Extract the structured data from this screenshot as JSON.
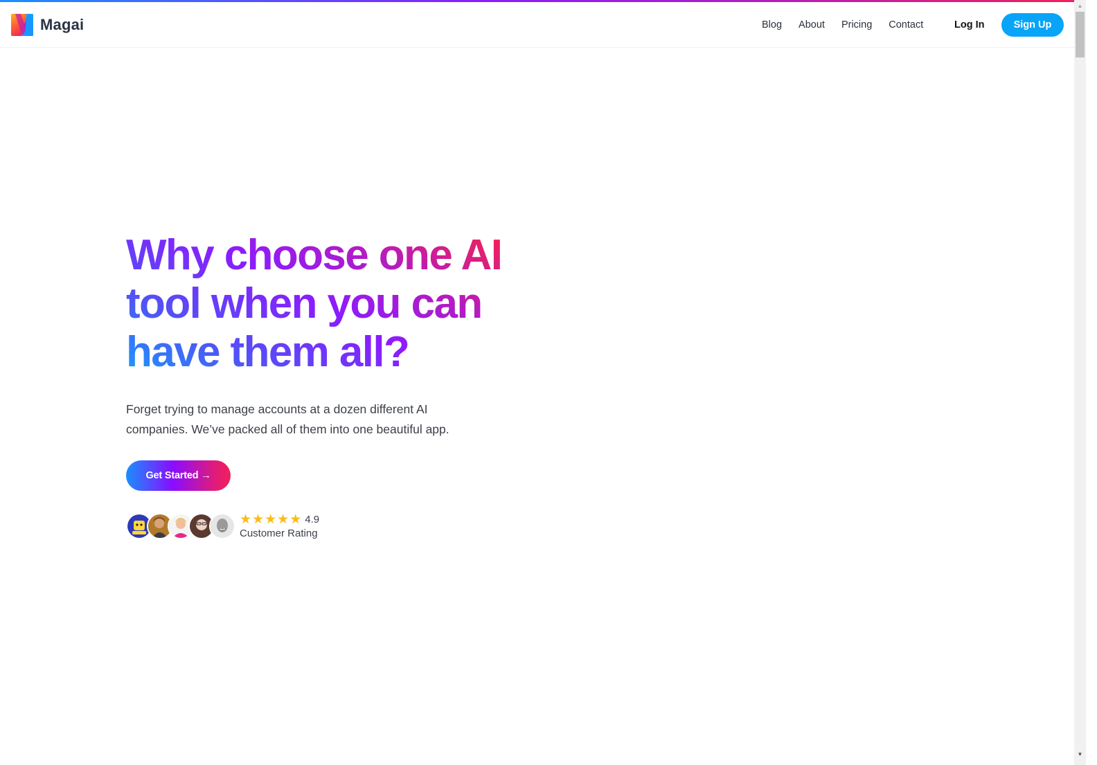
{
  "brand": {
    "name": "Magai",
    "logo_icon": "magai-v-logo-icon",
    "colors": {
      "gradient_blue": "#1a8fff",
      "gradient_purple": "#8a1cff",
      "gradient_pink": "#f0205a",
      "signup_blue": "#08a4f7",
      "star_yellow": "#fbbc14"
    }
  },
  "nav": {
    "links": [
      "Blog",
      "About",
      "Pricing",
      "Contact"
    ],
    "login_label": "Log In",
    "signup_label": "Sign Up"
  },
  "hero": {
    "title_lines": [
      "Why choose one AI",
      "tool when you can",
      "have them all?"
    ],
    "subtitle": "Forget trying to manage accounts at a dozen different AI companies. We’ve packed all of them into one beautiful app.",
    "cta_label": "Get Started →"
  },
  "rating": {
    "stars": 5,
    "score": "4.9",
    "label": "Customer Rating",
    "avatars": [
      "avatar-mascot",
      "avatar-person-1",
      "avatar-person-2",
      "avatar-person-3",
      "avatar-person-4"
    ]
  }
}
